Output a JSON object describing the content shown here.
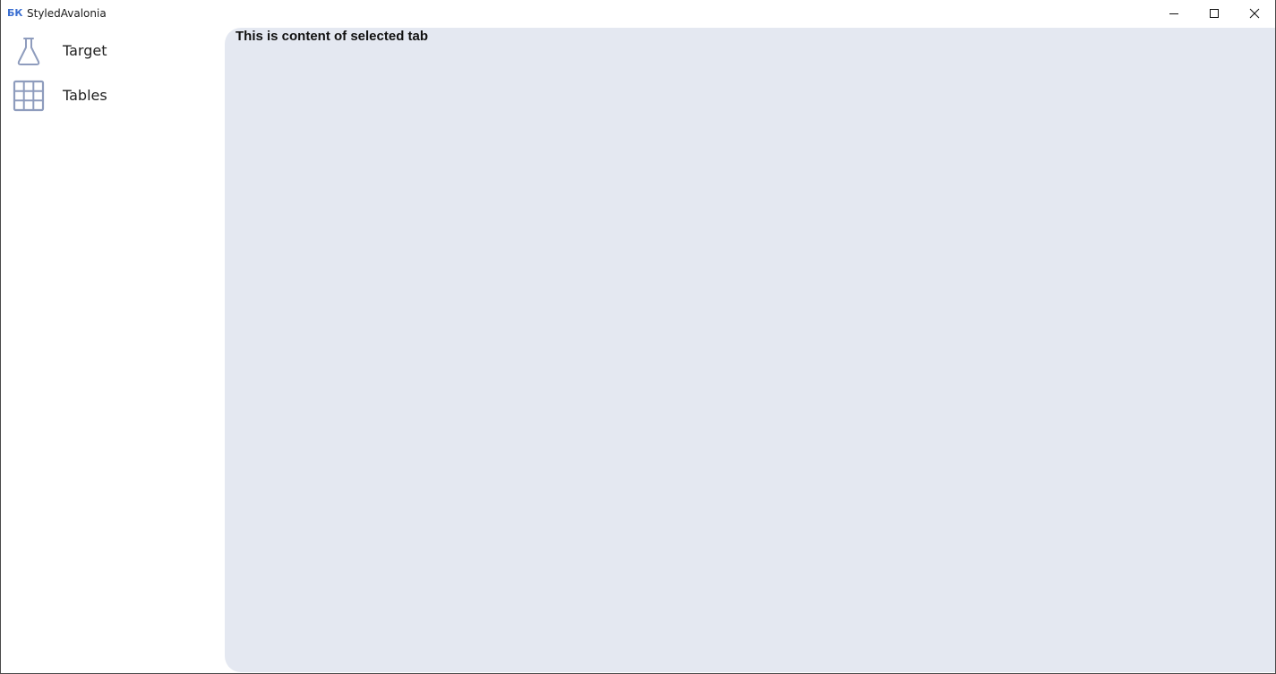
{
  "window": {
    "logo_text": "БК",
    "title": "StyledAvalonia",
    "controls": {
      "minimize": "minimize-icon",
      "maximize": "maximize-icon",
      "close": "close-icon"
    }
  },
  "sidebar": {
    "items": [
      {
        "label": "Target",
        "icon": "flask-icon"
      },
      {
        "label": "Tables",
        "icon": "table-grid-icon"
      }
    ]
  },
  "main": {
    "content_text": "This is content of selected tab"
  },
  "colors": {
    "content_bg": "#e4e8f1",
    "icon_color": "#8e9cbd",
    "logo_color": "#3b6fd1"
  }
}
